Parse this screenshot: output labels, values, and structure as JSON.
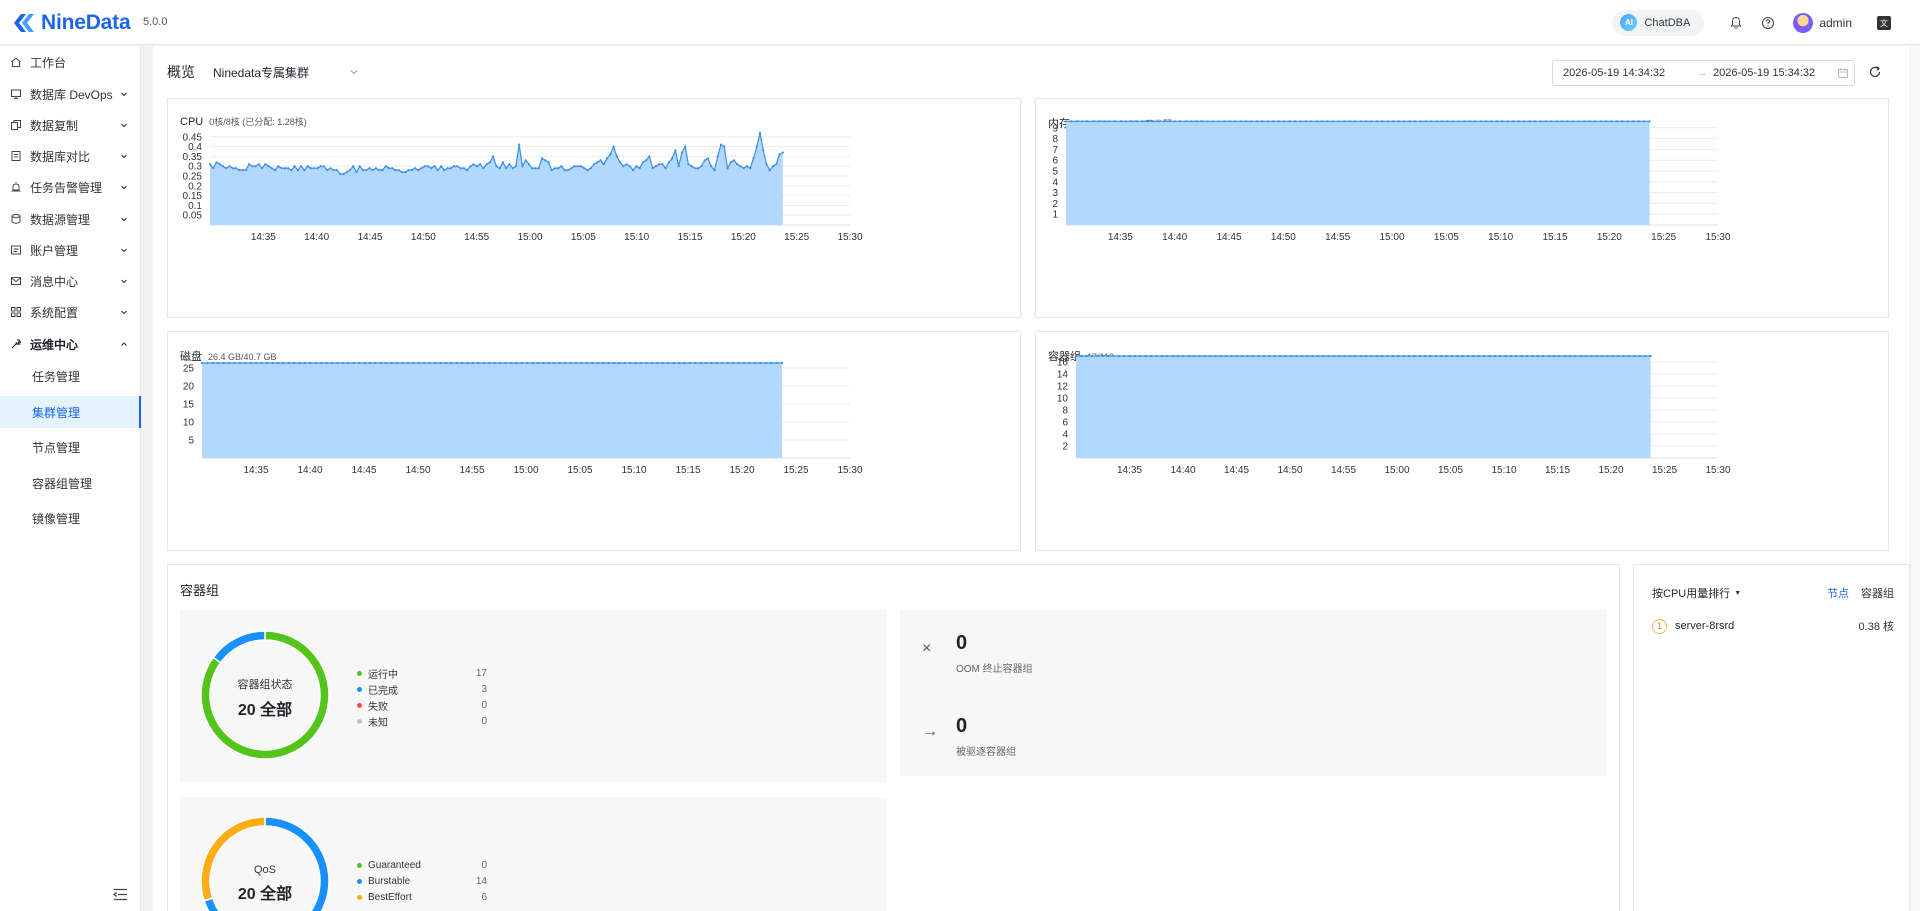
{
  "header": {
    "brand": "NineData",
    "version": "5.0.0",
    "chatdba": "ChatDBA",
    "chatdba_badge": "AI",
    "user": "admin"
  },
  "sidebar": {
    "items": [
      {
        "label": "工作台",
        "icon": "home-icon",
        "has_children": false
      },
      {
        "label": "数据库 DevOps",
        "icon": "monitor-icon",
        "has_children": true
      },
      {
        "label": "数据复制",
        "icon": "copy-icon",
        "has_children": true
      },
      {
        "label": "数据库对比",
        "icon": "compare-icon",
        "has_children": true
      },
      {
        "label": "任务告警管理",
        "icon": "alarm-icon",
        "has_children": true
      },
      {
        "label": "数据源管理",
        "icon": "database-icon",
        "has_children": true
      },
      {
        "label": "账户管理",
        "icon": "account-icon",
        "has_children": true
      },
      {
        "label": "消息中心",
        "icon": "mail-icon",
        "has_children": true
      },
      {
        "label": "系统配置",
        "icon": "grid-icon",
        "has_children": true
      },
      {
        "label": "运维中心",
        "icon": "wrench-icon",
        "has_children": true,
        "expanded": true
      }
    ],
    "sub_items": [
      {
        "label": "任务管理",
        "active": false
      },
      {
        "label": "集群管理",
        "active": true
      },
      {
        "label": "节点管理",
        "active": false
      },
      {
        "label": "容器组管理",
        "active": false
      },
      {
        "label": "镜像管理",
        "active": false
      }
    ]
  },
  "toolbar": {
    "title": "概览",
    "cluster": "Ninedata专属集群",
    "date_start": "2026-05-19 14:34:32",
    "date_end": "2026-05-19 15:34:32"
  },
  "colors": {
    "accent": "#1a66e8",
    "area_fill": "#b3d8ff",
    "area_line": "#3b8fe8",
    "green": "#52c41a",
    "blue": "#1890ff",
    "red": "#ff4d4f",
    "gray": "#bfbfbf",
    "orange": "#faad14"
  },
  "chart_data": [
    {
      "type": "area",
      "title": "CPU",
      "subtitle": "0核/8核 (已分配: 1.28核)",
      "yticks": [
        "0.05",
        "0.1",
        "0.15",
        "0.2",
        "0.25",
        "0.3",
        "0.35",
        "0.4",
        "0.45"
      ],
      "ylim": [
        0,
        0.5
      ],
      "xticks": [
        "14:35",
        "14:40",
        "14:45",
        "14:50",
        "14:55",
        "15:00",
        "15:05",
        "15:10",
        "15:15",
        "15:20",
        "15:25",
        "15:30"
      ],
      "xlim": [
        0,
        60
      ],
      "x_start": 0,
      "x_step": 0.5,
      "values": [
        0.31,
        0.29,
        0.32,
        0.31,
        0.3,
        0.29,
        0.3,
        0.29,
        0.29,
        0.28,
        0.28,
        0.28,
        0.31,
        0.3,
        0.3,
        0.31,
        0.29,
        0.31,
        0.3,
        0.29,
        0.28,
        0.3,
        0.29,
        0.29,
        0.29,
        0.28,
        0.3,
        0.28,
        0.3,
        0.28,
        0.3,
        0.29,
        0.29,
        0.29,
        0.3,
        0.3,
        0.28,
        0.29,
        0.28,
        0.28,
        0.26,
        0.26,
        0.27,
        0.28,
        0.3,
        0.27,
        0.3,
        0.28,
        0.28,
        0.29,
        0.28,
        0.29,
        0.28,
        0.28,
        0.3,
        0.29,
        0.29,
        0.28,
        0.28,
        0.27,
        0.27,
        0.28,
        0.28,
        0.29,
        0.28,
        0.29,
        0.3,
        0.3,
        0.29,
        0.3,
        0.28,
        0.3,
        0.28,
        0.29,
        0.29,
        0.3,
        0.3,
        0.29,
        0.29,
        0.28,
        0.3,
        0.31,
        0.3,
        0.31,
        0.29,
        0.31,
        0.32,
        0.35,
        0.3,
        0.29,
        0.32,
        0.29,
        0.31,
        0.29,
        0.3,
        0.41,
        0.3,
        0.33,
        0.31,
        0.29,
        0.29,
        0.29,
        0.34,
        0.33,
        0.32,
        0.28,
        0.29,
        0.29,
        0.3,
        0.28,
        0.28,
        0.29,
        0.3,
        0.3,
        0.3,
        0.29,
        0.28,
        0.29,
        0.31,
        0.32,
        0.33,
        0.31,
        0.34,
        0.36,
        0.4,
        0.35,
        0.32,
        0.3,
        0.31,
        0.3,
        0.28,
        0.3,
        0.29,
        0.32,
        0.33,
        0.35,
        0.29,
        0.3,
        0.31,
        0.31,
        0.29,
        0.32,
        0.34,
        0.38,
        0.3,
        0.37,
        0.4,
        0.31,
        0.3,
        0.29,
        0.29,
        0.3,
        0.33,
        0.34,
        0.3,
        0.28,
        0.35,
        0.41,
        0.4,
        0.29,
        0.32,
        0.33,
        0.31,
        0.3,
        0.29,
        0.3,
        0.29,
        0.34,
        0.4,
        0.47,
        0.38,
        0.31,
        0.28,
        0.3,
        0.31,
        0.36,
        0.37
      ]
    },
    {
      "type": "area",
      "title": "内存",
      "subtitle": "9.6 GB/30.8 GB (已分配: 3.9 GB)",
      "yticks": [
        "1",
        "2",
        "3",
        "4",
        "5",
        "6",
        "7",
        "8",
        "9"
      ],
      "ylim": [
        0,
        10
      ],
      "xticks": [
        "14:35",
        "14:40",
        "14:45",
        "14:50",
        "14:55",
        "15:00",
        "15:05",
        "15:10",
        "15:15",
        "15:20",
        "15:25",
        "15:30"
      ],
      "xlim": [
        0,
        60
      ],
      "x_start": 0,
      "x_step": 0.5,
      "constant_value": 9.6,
      "n_points": 108
    },
    {
      "type": "area",
      "title": "磁盘",
      "subtitle": "26.4 GB/40.7 GB",
      "yticks": [
        "5",
        "10",
        "15",
        "20",
        "25"
      ],
      "ylim": [
        0,
        30
      ],
      "xticks": [
        "14:35",
        "14:40",
        "14:45",
        "14:50",
        "14:55",
        "15:00",
        "15:05",
        "15:10",
        "15:15",
        "15:20",
        "15:25",
        "15:30"
      ],
      "xlim": [
        0,
        60
      ],
      "x_start": 0,
      "x_step": 0.5,
      "constant_value": 26.4,
      "n_points": 108
    },
    {
      "type": "area",
      "title": "容器组",
      "subtitle": "17/110",
      "yticks": [
        "2",
        "4",
        "6",
        "8",
        "10",
        "12",
        "14",
        "16"
      ],
      "ylim": [
        0,
        18
      ],
      "xticks": [
        "14:35",
        "14:40",
        "14:45",
        "14:50",
        "14:55",
        "15:00",
        "15:05",
        "15:10",
        "15:15",
        "15:20",
        "15:25",
        "15:30"
      ],
      "xlim": [
        0,
        60
      ],
      "x_start": 0,
      "x_step": 0.5,
      "constant_value": 17,
      "n_points": 108
    }
  ],
  "pods": {
    "title": "容器组",
    "status_donut": {
      "center_label": "容器组状态",
      "center_value": "20 全部",
      "legend": [
        {
          "name": "运行中",
          "value": 17,
          "color": "#52c41a"
        },
        {
          "name": "已完成",
          "value": 3,
          "color": "#1890ff"
        },
        {
          "name": "失败",
          "value": 0,
          "color": "#ff4d4f"
        },
        {
          "name": "未知",
          "value": 0,
          "color": "#bfbfbf"
        }
      ]
    },
    "qos_donut": {
      "center_label": "QoS",
      "center_value": "20 全部",
      "legend": [
        {
          "name": "Guaranteed",
          "value": 0,
          "color": "#52c41a"
        },
        {
          "name": "Burstable",
          "value": 14,
          "color": "#1890ff"
        },
        {
          "name": "BestEffort",
          "value": 6,
          "color": "#faad14"
        }
      ]
    },
    "oom": {
      "value": "0",
      "label": "OOM 终止容器组",
      "icon": "close-icon"
    },
    "evicted": {
      "value": "0",
      "label": "被驱逐容器组",
      "icon": "arrow-right-icon"
    }
  },
  "ranking": {
    "title": "按CPU用量排行",
    "tabs": [
      "节点",
      "容器组"
    ],
    "active_tab": "节点",
    "rows": [
      {
        "rank": "1",
        "name": "server-8rsrd",
        "value": "0.38 核"
      }
    ]
  }
}
